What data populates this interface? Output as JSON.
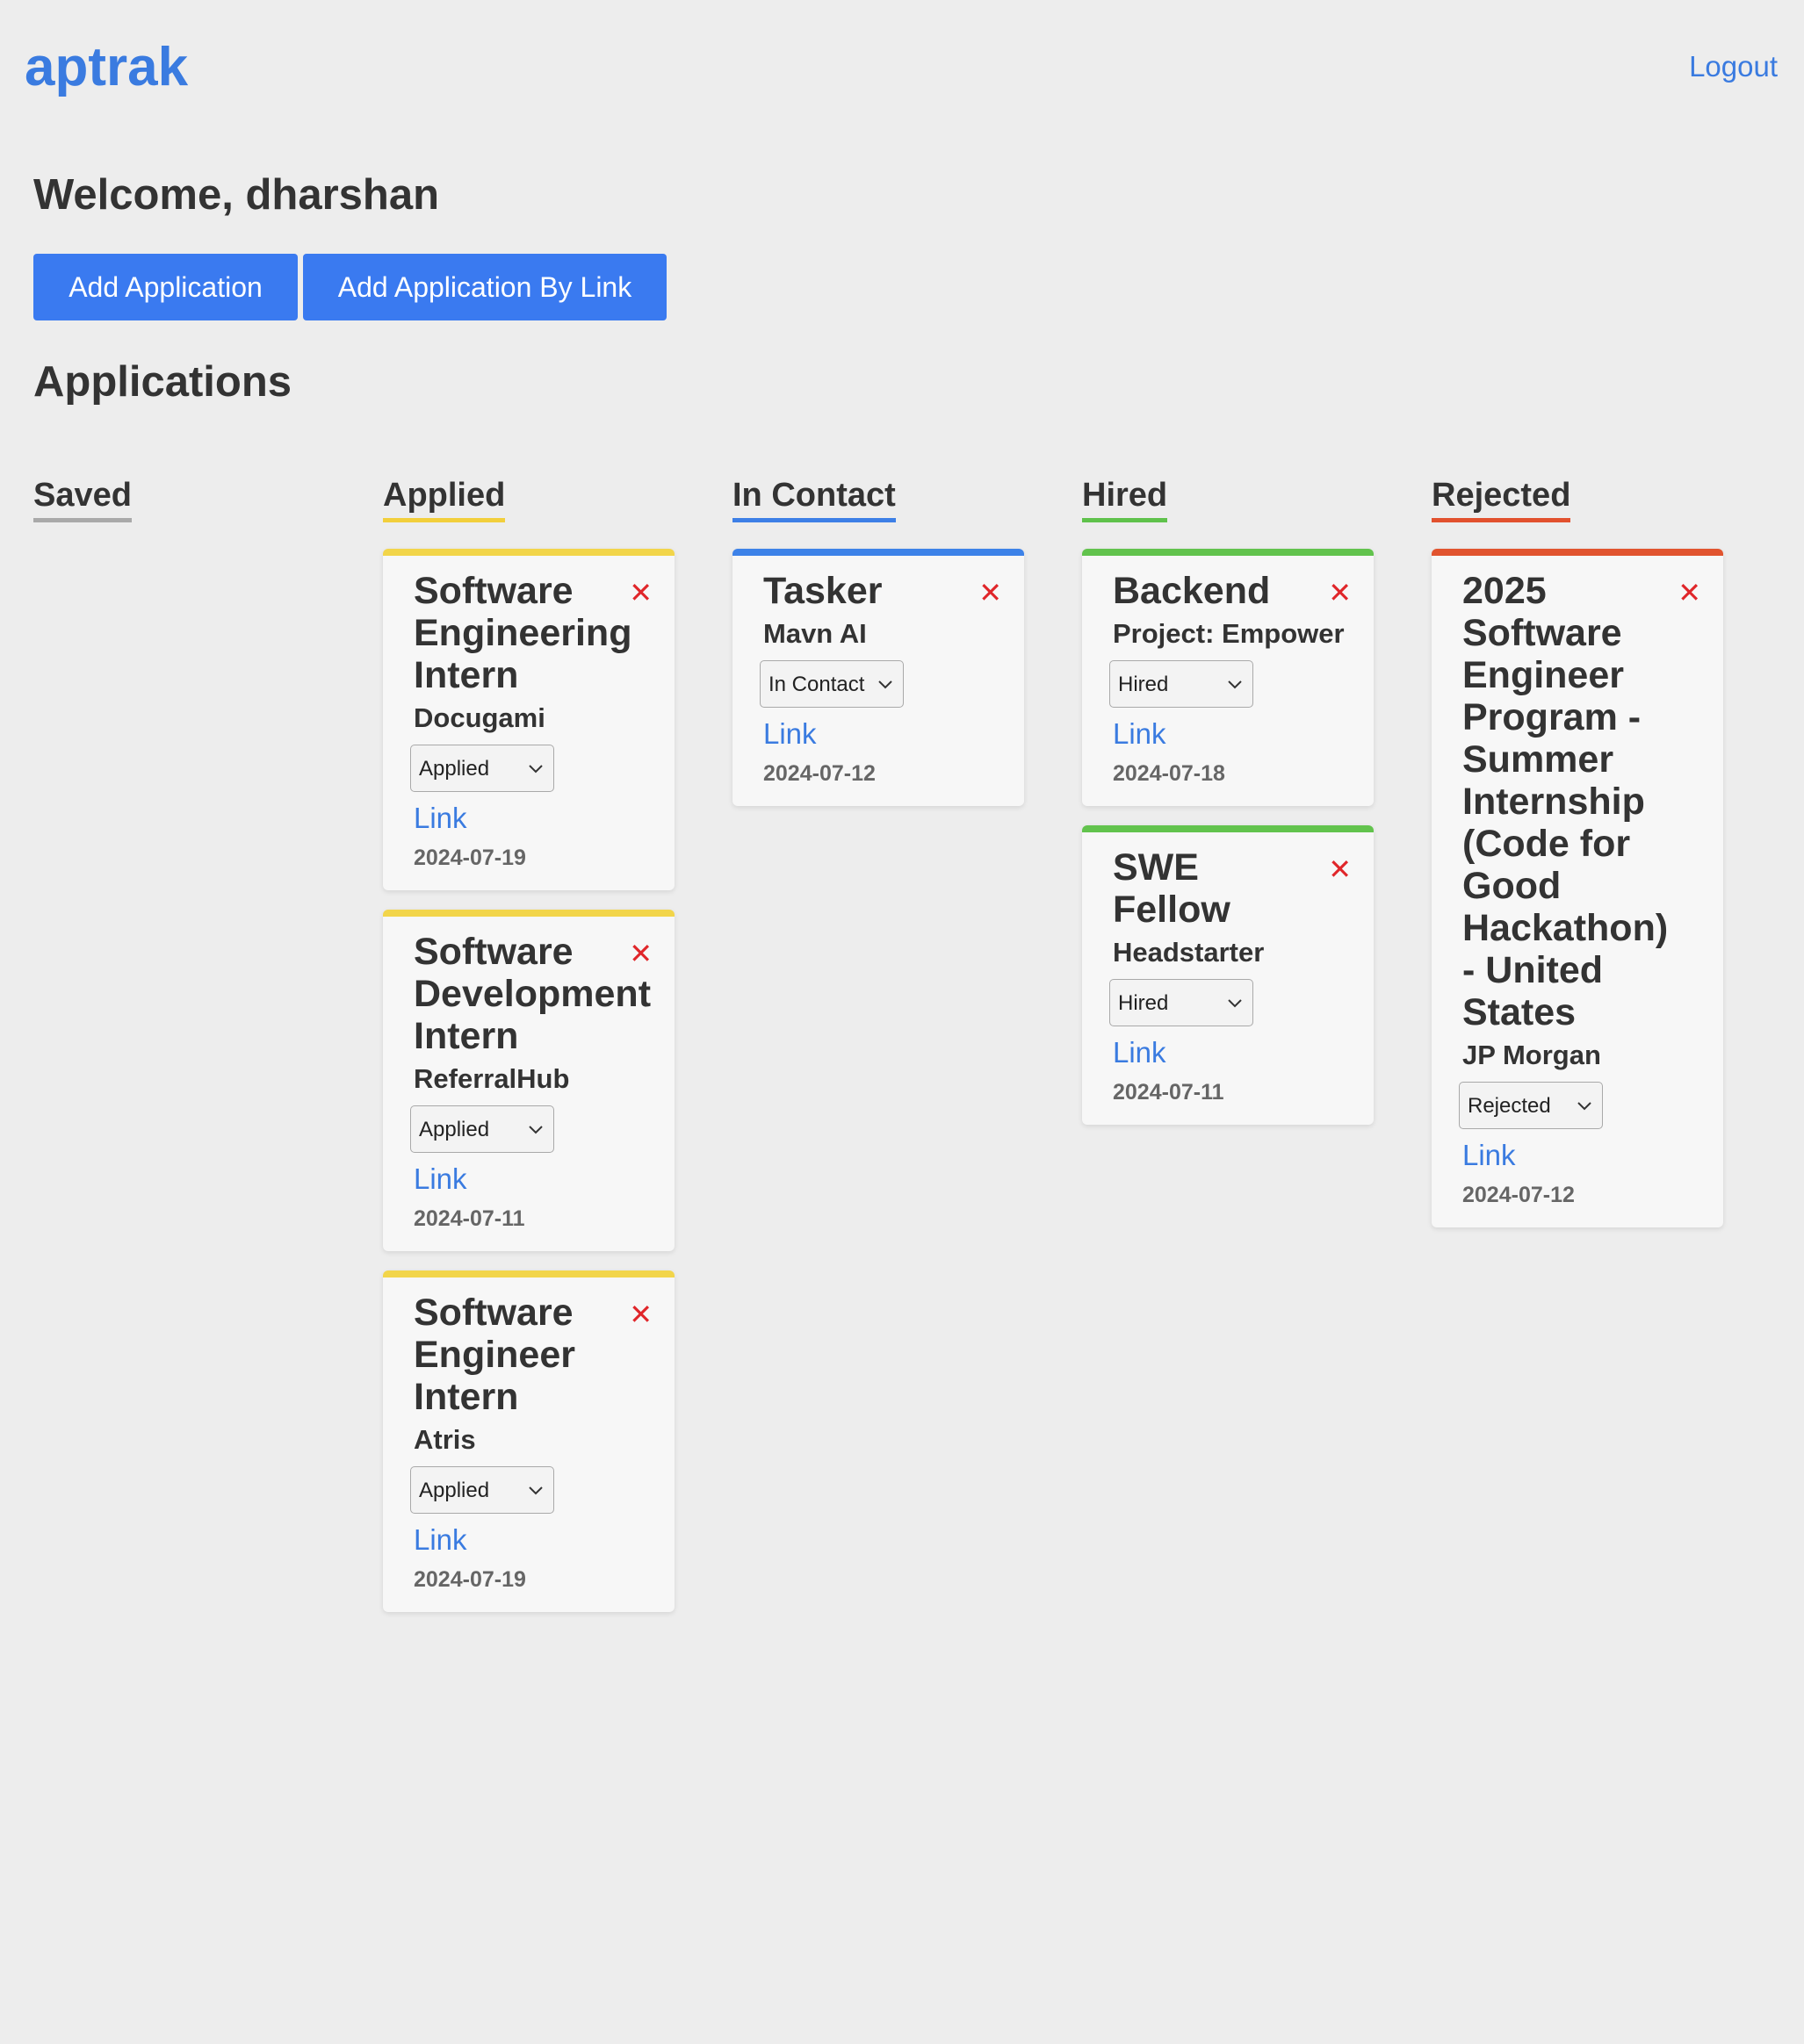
{
  "header": {
    "logo": "aptrak",
    "logout_label": "Logout"
  },
  "welcome": "Welcome, dharshan",
  "buttons": {
    "add_application": "Add Application",
    "add_application_by_link": "Add Application By Link"
  },
  "applications_title": "Applications",
  "colors": {
    "accent": "#3a7be0",
    "button": "#3a7af0",
    "saved": "#a9a9a9",
    "applied": "#f2cf3c",
    "in_contact": "#3d7fe6",
    "hired": "#5fc24b",
    "rejected": "#e2512e",
    "delete": "#e0262a"
  },
  "columns": {
    "saved": {
      "title": "Saved",
      "cards": []
    },
    "applied": {
      "title": "Applied",
      "cards": [
        {
          "title": "Software Engineering Intern",
          "company": "Docugami",
          "status": "Applied",
          "link": "Link",
          "date": "2024-07-19"
        },
        {
          "title": "Software Development Intern",
          "company": "ReferralHub",
          "status": "Applied",
          "link": "Link",
          "date": "2024-07-11"
        },
        {
          "title": "Software Engineer Intern",
          "company": "Atris",
          "status": "Applied",
          "link": "Link",
          "date": "2024-07-19"
        }
      ]
    },
    "in_contact": {
      "title": "In Contact",
      "cards": [
        {
          "title": "Tasker",
          "company": "Mavn AI",
          "status": "In Contact",
          "link": "Link",
          "date": "2024-07-12"
        }
      ]
    },
    "hired": {
      "title": "Hired",
      "cards": [
        {
          "title": "Backend",
          "company": "Project: Empower",
          "status": "Hired",
          "link": "Link",
          "date": "2024-07-18"
        },
        {
          "title": "SWE Fellow",
          "company": "Headstarter",
          "status": "Hired",
          "link": "Link",
          "date": "2024-07-11"
        }
      ]
    },
    "rejected": {
      "title": "Rejected",
      "cards": [
        {
          "title": "2025 Software Engineer Program - Summer Internship (Code for Good Hackathon) - United States",
          "company": "JP Morgan",
          "status": "Rejected",
          "link": "Link",
          "date": "2024-07-12"
        }
      ]
    }
  },
  "icons": {
    "delete": "close-icon",
    "dropdown": "chevron-down-icon"
  }
}
